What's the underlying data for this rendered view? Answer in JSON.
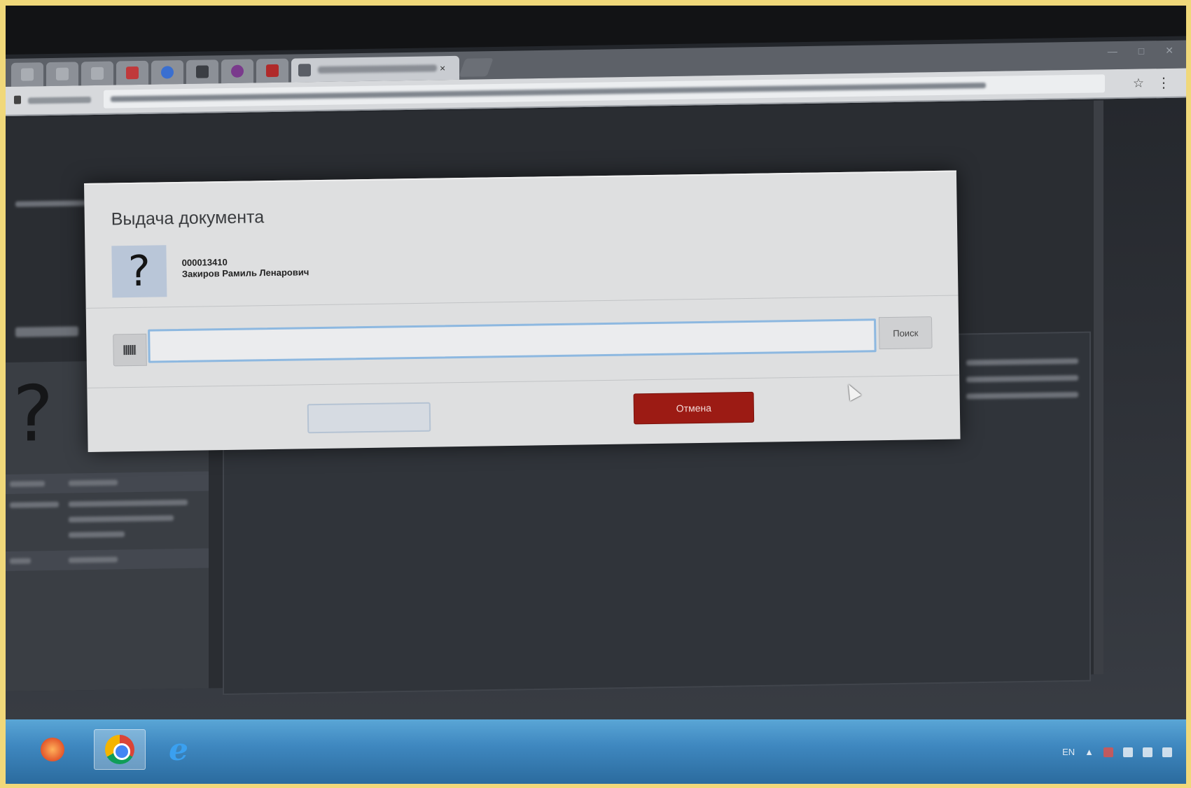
{
  "dialog": {
    "title": "Выдача документа",
    "avatar_glyph": "?",
    "person_id": "000013410",
    "person_name": "Закиров Рамиль Ленарович",
    "search_value": "",
    "search_button_label": "Поиск",
    "ok_button_label": "",
    "cancel_button_label": "Отмена",
    "cancel_color": "#9c1b14"
  },
  "browser": {
    "tab_count": 9,
    "active_tab_close": "×"
  },
  "background_page": {
    "avatar_glyph": "?"
  },
  "taskbar": {
    "pinned_apps": [
      "media-player-icon",
      "chrome-icon",
      "internet-explorer-icon"
    ],
    "active_app": "chrome-icon",
    "language": "EN"
  }
}
